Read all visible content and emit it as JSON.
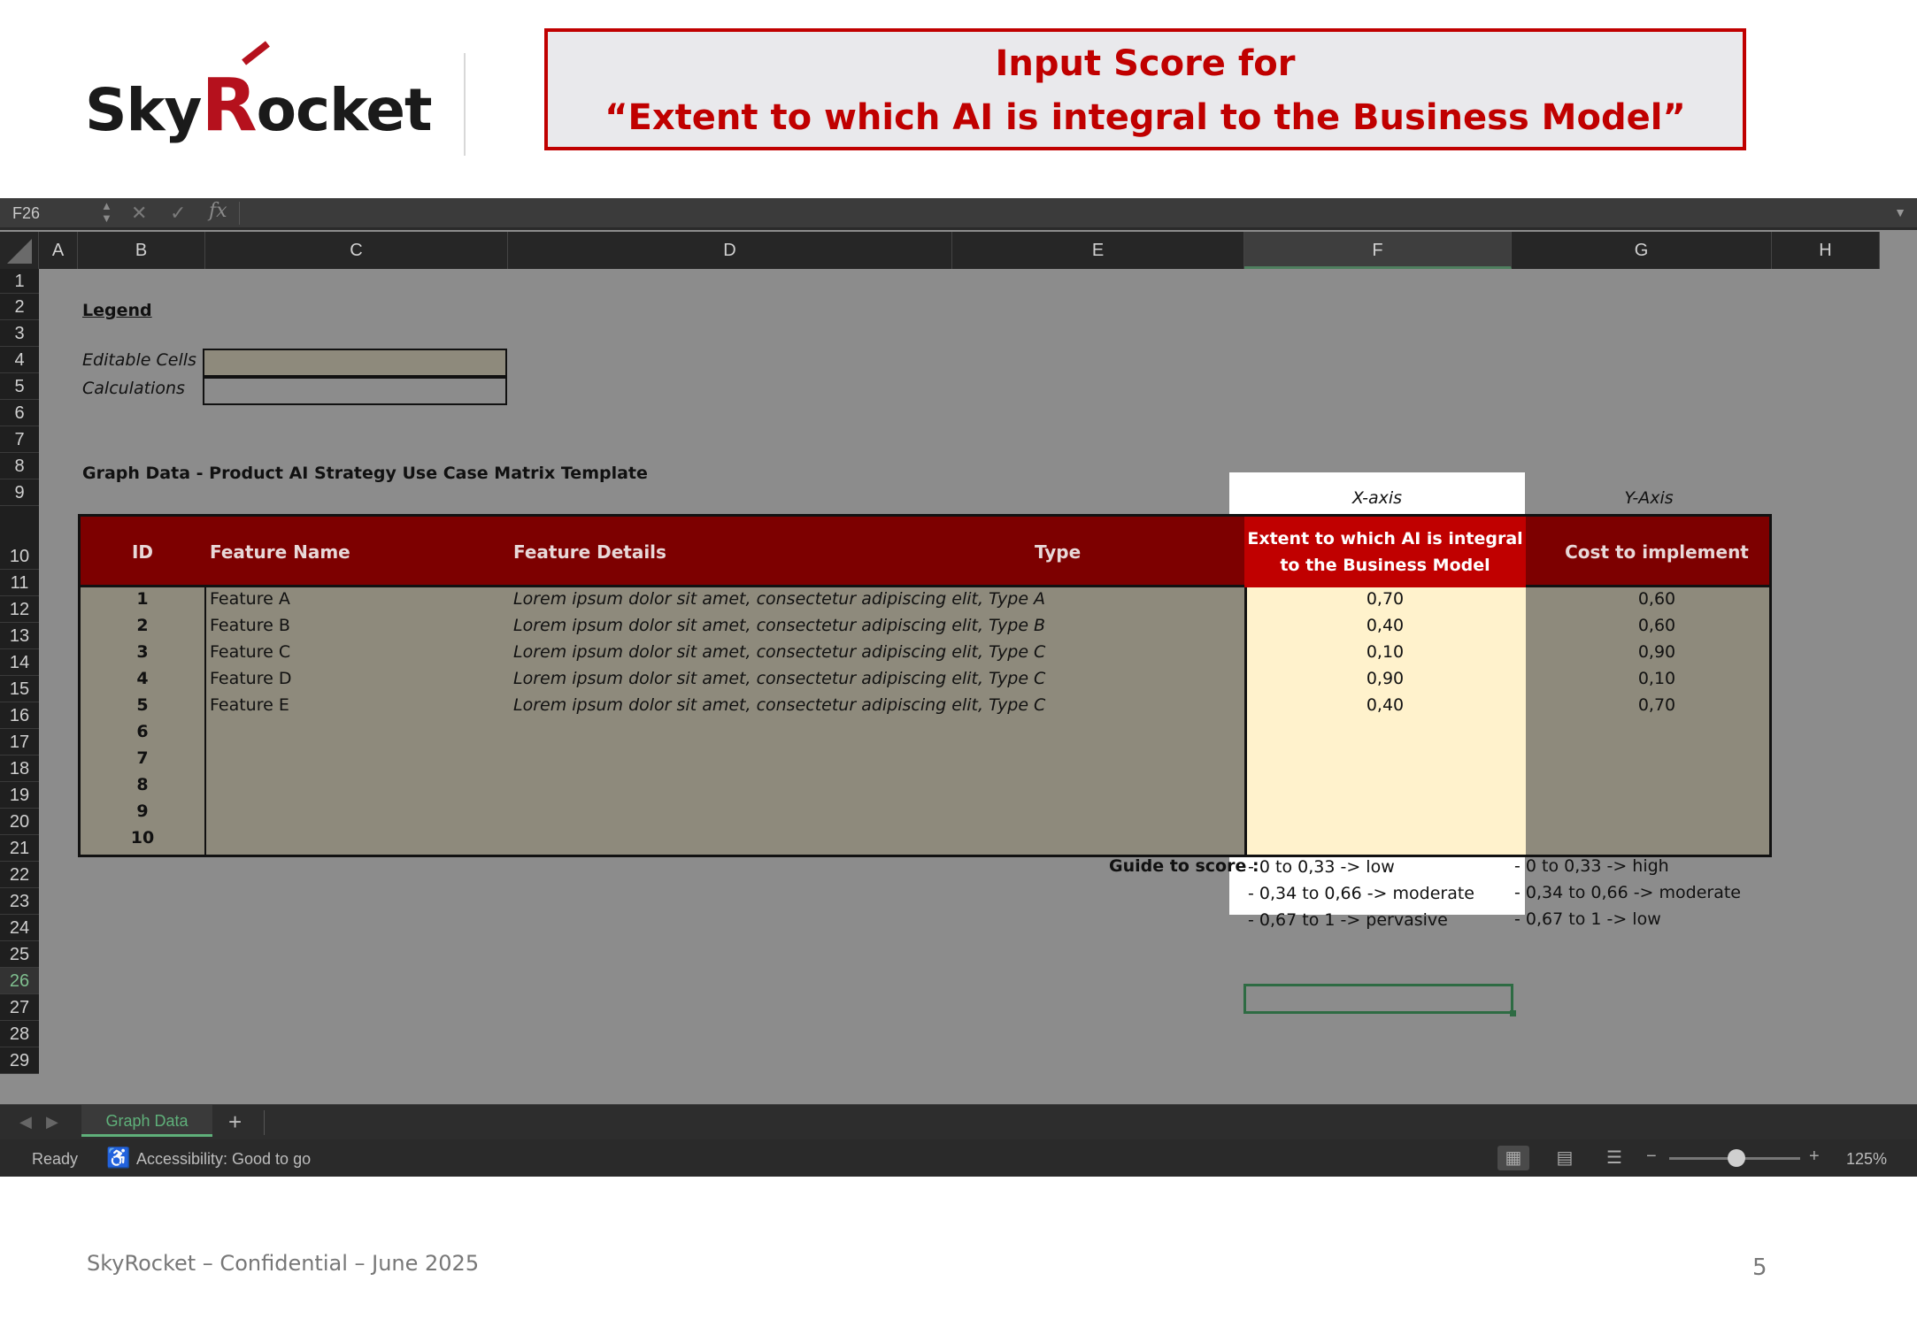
{
  "slide": {
    "logo_text": "SkyRocket",
    "title_line1": "Input Score for",
    "title_line2": "“Extent to which AI is integral to the Business Model”",
    "footer": "SkyRocket – Confidential – June 2025",
    "page_number": "5"
  },
  "formula_bar": {
    "name_box": "F26",
    "fx_label": "fx"
  },
  "columns": [
    "A",
    "B",
    "C",
    "D",
    "E",
    "F",
    "G",
    "H"
  ],
  "selected_column": "F",
  "rows": [
    "1",
    "2",
    "3",
    "4",
    "5",
    "6",
    "7",
    "8",
    "9",
    "10",
    "11",
    "12",
    "13",
    "14",
    "15",
    "16",
    "17",
    "18",
    "19",
    "20",
    "21",
    "22",
    "23",
    "24",
    "25",
    "26",
    "27",
    "28",
    "29"
  ],
  "selected_row": "26",
  "legend": {
    "title": "Legend",
    "editable_label": "Editable Cells",
    "calculations_label": "Calculations",
    "editable_color": "#8e8a7c",
    "calculations_color": "#8c8c8c"
  },
  "graph_title": "Graph Data - Product AI Strategy Use Case Matrix Template",
  "axes": {
    "x_label": "X-axis",
    "y_label": "Y-Axis"
  },
  "table": {
    "headers": {
      "id": "ID",
      "name": "Feature Name",
      "details": "Feature Details",
      "type": "Type",
      "x": "Extent to which AI is integral to the Business Model",
      "y": "Cost to implement"
    },
    "rows": [
      {
        "id": "1",
        "name": "Feature A",
        "details": "Lorem ipsum dolor sit amet, consectetur adipiscing elit, Type A",
        "x": "0,70",
        "y": "0,60"
      },
      {
        "id": "2",
        "name": "Feature B",
        "details": "Lorem ipsum dolor sit amet, consectetur adipiscing elit, Type B",
        "x": "0,40",
        "y": "0,60"
      },
      {
        "id": "3",
        "name": "Feature C",
        "details": "Lorem ipsum dolor sit amet, consectetur adipiscing elit, Type C",
        "x": "0,10",
        "y": "0,90"
      },
      {
        "id": "4",
        "name": "Feature D",
        "details": "Lorem ipsum dolor sit amet, consectetur adipiscing elit, Type C",
        "x": "0,90",
        "y": "0,10"
      },
      {
        "id": "5",
        "name": "Feature E",
        "details": "Lorem ipsum dolor sit amet, consectetur adipiscing elit, Type C",
        "x": "0,40",
        "y": "0,70"
      },
      {
        "id": "6",
        "name": "",
        "details": "",
        "x": "",
        "y": ""
      },
      {
        "id": "7",
        "name": "",
        "details": "",
        "x": "",
        "y": ""
      },
      {
        "id": "8",
        "name": "",
        "details": "",
        "x": "",
        "y": ""
      },
      {
        "id": "9",
        "name": "",
        "details": "",
        "x": "",
        "y": ""
      },
      {
        "id": "10",
        "name": "",
        "details": "",
        "x": "",
        "y": ""
      }
    ]
  },
  "guide": {
    "label": "Guide to score :",
    "x": [
      "- 0 to 0,33 -> low",
      "- 0,34 to 0,66 -> moderate",
      "- 0,67 to 1 -> pervasive"
    ],
    "y": [
      "- 0 to 0,33 -> high",
      "- 0,34 to 0,66 -> moderate",
      "- 0,67 to 1 -> low"
    ]
  },
  "sheet_tabs": [
    "Graph Data"
  ],
  "status": {
    "ready": "Ready",
    "accessibility": "Accessibility: Good to go",
    "zoom": "125%"
  }
}
